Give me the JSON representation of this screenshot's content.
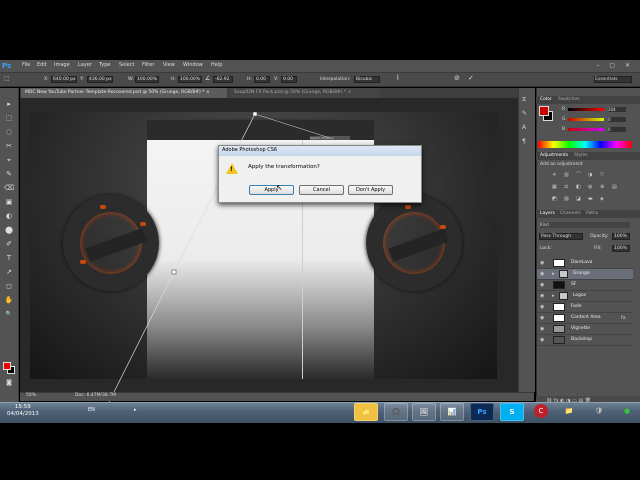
{
  "app": {
    "logo": "Ps"
  },
  "menu": [
    "File",
    "Edit",
    "Image",
    "Layer",
    "Type",
    "Select",
    "Filter",
    "View",
    "Window",
    "Help"
  ],
  "window_controls": "– ▢ ✕",
  "options": {
    "x_label": "X:",
    "x_value": "640.00 px",
    "y_label": "Y:",
    "y_value": "436.00 px",
    "w_label": "W:",
    "w_value": "100.00%",
    "h_label": "H:",
    "h_value": "100.00%",
    "angle_value": "-62.92",
    "hskew_label": "H:",
    "hskew_value": "0.00",
    "vskew_label": "V:",
    "vskew_value": "0.00",
    "interp_label": "Interpolation:",
    "interp_value": "Bicubic",
    "workspace": "Essentials"
  },
  "tabs": [
    {
      "label": "MDC New YouTube Partner Template-Recovered.psd @ 50% (Grunge, RGB/8#) *",
      "close": "×"
    },
    {
      "label": "Soup02N FX Pack.psd @ 50% (Grunge, RGB/8#) *",
      "close": "×"
    }
  ],
  "tools": [
    "▸",
    "⬚",
    "◌",
    "✂",
    "⌖",
    "✎",
    "⌫",
    "▣",
    "◐",
    "⬤",
    "✐",
    "T",
    "↗",
    "◻",
    "✋",
    "🔍"
  ],
  "mockup": {
    "search": "Search Channel"
  },
  "dialog": {
    "title": "Adobe Photoshop CS6",
    "message": "Apply the transformation?",
    "apply": "Apply",
    "cancel": "Cancel",
    "dont_apply": "Don't Apply"
  },
  "status": {
    "zoom": "50%",
    "doc": "Doc: 6.47M/38.7M"
  },
  "panels": {
    "color_tabs": [
      "Color",
      "Swatches"
    ],
    "rgb": [
      {
        "label": "R",
        "value": "204"
      },
      {
        "label": "G",
        "value": "0"
      },
      {
        "label": "B",
        "value": "0"
      }
    ],
    "adjust_tabs": [
      "Adjustments",
      "Styles"
    ],
    "adjust_title": "Add an adjustment",
    "layers_tabs": [
      "Layers",
      "Channels",
      "Paths"
    ],
    "filter": "Kind",
    "blend": "Pass Through",
    "opacity_label": "Opacity:",
    "opacity_value": "100%",
    "lock_label": "Lock:",
    "fill_label": "Fill:",
    "fill_value": "100%",
    "layers": [
      {
        "name": "DareLava",
        "selected": false
      },
      {
        "name": "Grunge",
        "selected": true
      },
      {
        "name": "SF",
        "selected": false
      },
      {
        "name": "Logos",
        "selected": false
      },
      {
        "name": "Fade",
        "selected": false
      },
      {
        "name": "Content Area",
        "selected": false
      },
      {
        "name": "Vignette",
        "selected": false
      },
      {
        "name": "Backdrop",
        "selected": false
      }
    ],
    "bottom_icons": "⛓ fx ◐ ◑ ▭ ▤ 🗑"
  },
  "taskbar": {
    "time": "15:59",
    "date": "04/04/2013",
    "lang": "EN",
    "apps": [
      "📁",
      "🎧",
      "🖼",
      "📊",
      "Ps",
      "S"
    ],
    "tray": [
      "C",
      "📁",
      "🛡",
      "●"
    ]
  },
  "colors": {
    "menubar": "#535353",
    "canvas": "#282828",
    "accent": "#35a2ff",
    "foreground": "#cc0000"
  }
}
